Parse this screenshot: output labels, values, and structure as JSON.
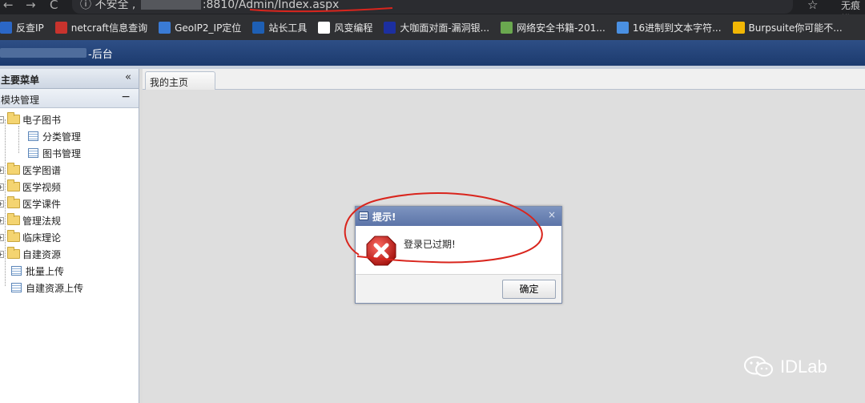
{
  "browser": {
    "back": "←",
    "forward": "→",
    "reload": "C",
    "security_label": "不安全",
    "url_visible": ":8810/Admin/Index.aspx",
    "star": "☆",
    "profile": "无痕模"
  },
  "bookmarks": [
    {
      "label": "反查IP",
      "icon_color": "#2b67c6"
    },
    {
      "label": "netcraft信息查询",
      "icon_color": "#c8332d"
    },
    {
      "label": "GeoIP2_IP定位",
      "icon_color": "#3a7bd5"
    },
    {
      "label": "站长工具",
      "icon_color": "#1e5fb4"
    },
    {
      "label": "风变编程",
      "icon_color": "#ffffff"
    },
    {
      "label": "大咖面对面-漏洞银...",
      "icon_color": "#1c2fa0"
    },
    {
      "label": "网络安全书籍-201...",
      "icon_color": "#6aa84f"
    },
    {
      "label": "16进制到文本字符...",
      "icon_color": "#4a90e2"
    },
    {
      "label": "Burpsuite你可能不...",
      "icon_color": "#f2b705"
    }
  ],
  "app": {
    "title": "-后台"
  },
  "sidebar": {
    "header": "主要菜单",
    "collapse": "«",
    "section": "模块管理",
    "section_toggle": "−",
    "tree": [
      {
        "label": "电子图书",
        "type": "folder",
        "expanded": true
      },
      {
        "label": "分类管理",
        "type": "page",
        "level": 2
      },
      {
        "label": "图书管理",
        "type": "page",
        "level": 2
      },
      {
        "label": "医学图谱",
        "type": "folder"
      },
      {
        "label": "医学视频",
        "type": "folder"
      },
      {
        "label": "医学课件",
        "type": "folder"
      },
      {
        "label": "管理法规",
        "type": "folder"
      },
      {
        "label": "临床理论",
        "type": "folder"
      },
      {
        "label": "自建资源",
        "type": "folder"
      },
      {
        "label": "批量上传",
        "type": "page"
      },
      {
        "label": "自建资源上传",
        "type": "page"
      }
    ]
  },
  "main": {
    "tab": "我的主页"
  },
  "dialog": {
    "title": "提示!",
    "close": "×",
    "message": "登录已过期!",
    "ok": "确定"
  },
  "watermark": "IDLab",
  "colors": {
    "annotation": "#d9251d",
    "app_bar": "#24447a",
    "dialog_header": "#6a81b3"
  }
}
